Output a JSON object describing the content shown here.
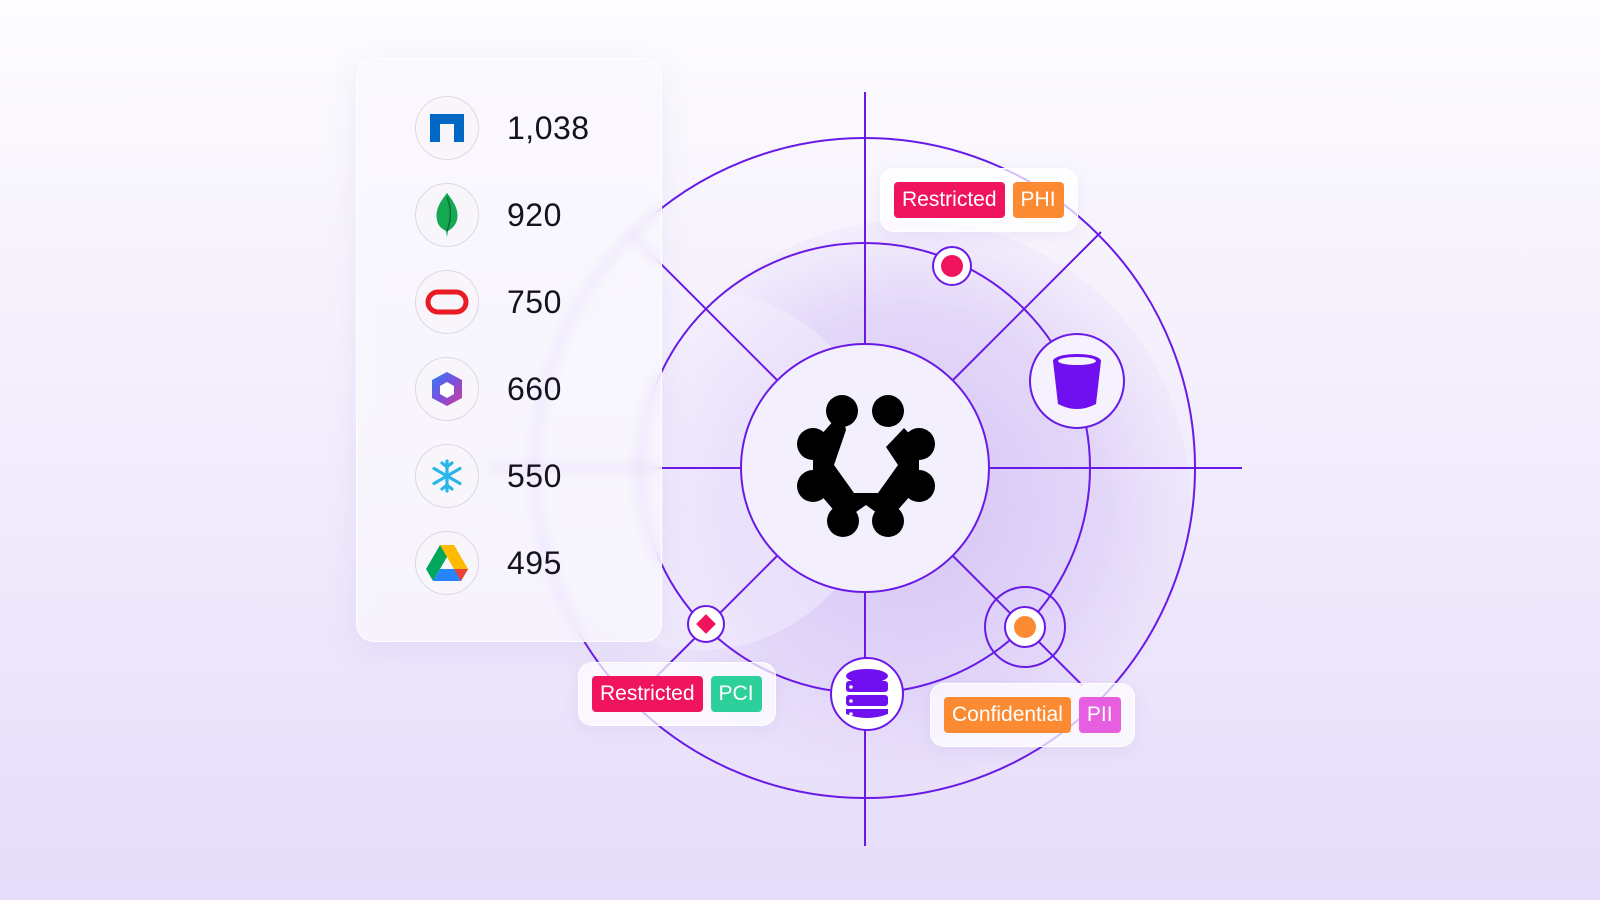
{
  "sources": [
    {
      "name": "NetApp",
      "icon": "netapp-logo-icon",
      "count": "1,038"
    },
    {
      "name": "MongoDB",
      "icon": "mongodb-leaf-icon",
      "count": "920"
    },
    {
      "name": "Oracle",
      "icon": "oracle-logo-icon",
      "count": "750"
    },
    {
      "name": "Microsoft 365",
      "icon": "microsoft-365-logo-icon",
      "count": "660"
    },
    {
      "name": "Snowflake",
      "icon": "snowflake-logo-icon",
      "count": "550"
    },
    {
      "name": "Google Drive",
      "icon": "google-drive-logo-icon",
      "count": "495"
    }
  ],
  "tags": {
    "phi": {
      "level": "Restricted",
      "type": "PHI"
    },
    "pci": {
      "level": "Restricted",
      "type": "PCI"
    },
    "pii": {
      "level": "Confidential",
      "type": "PII"
    }
  },
  "colors": {
    "line": "#6a1ae6",
    "restricted": "#f0145f",
    "confidential": "#fb8a32",
    "phi": "#fb8a32",
    "pci": "#2dcf9b",
    "pii": "#e85ee0",
    "node_fill": "#7010f0"
  },
  "nodes": {
    "center": "brand-logo-icon",
    "bucket": "storage-bucket-icon",
    "database": "database-icon"
  }
}
